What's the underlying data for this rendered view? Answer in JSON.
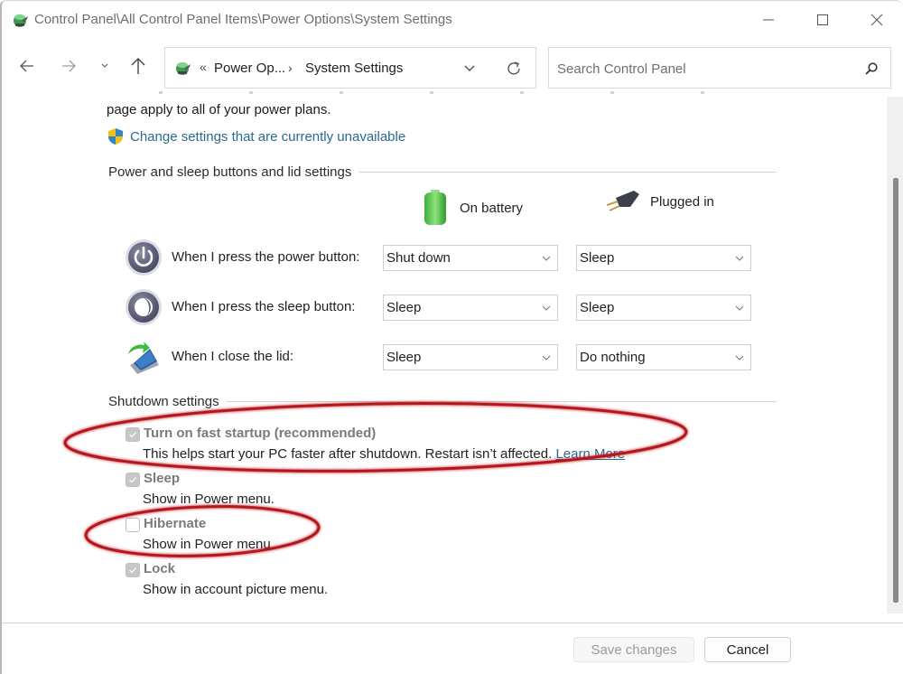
{
  "window": {
    "title": "Control Panel\\All Control Panel Items\\Power Options\\System Settings",
    "controls": {
      "minimize": "minimize",
      "maximize": "maximize",
      "close": "close"
    }
  },
  "navigation": {
    "back_icon": "arrow-left-icon",
    "forward_icon": "arrow-right-icon",
    "recent_icon": "chevron-down-icon",
    "up_icon": "arrow-up-icon",
    "address": {
      "overflow_glyph": "«",
      "segments": [
        "Power Op...",
        "System Settings"
      ],
      "separator": "›"
    },
    "search": {
      "placeholder": "Search Control Panel",
      "value": ""
    }
  },
  "content": {
    "intro_text": "page apply to all of your power plans.",
    "uac_link": "Change settings that are currently unavailable",
    "power_group": {
      "title": "Power and sleep buttons and lid settings",
      "columns": [
        "On battery",
        "Plugged in"
      ],
      "rows": [
        {
          "label": "When I press the power button:",
          "icon": "power-button-icon",
          "on_battery": "Shut down",
          "plugged_in": "Sleep"
        },
        {
          "label": "When I press the sleep button:",
          "icon": "sleep-button-icon",
          "on_battery": "Sleep",
          "plugged_in": "Sleep"
        },
        {
          "label": "When I close the lid:",
          "icon": "laptop-lid-icon",
          "on_battery": "Sleep",
          "plugged_in": "Do nothing"
        }
      ]
    },
    "shutdown_group": {
      "title": "Shutdown settings",
      "items": [
        {
          "title": "Turn on fast startup (recommended)",
          "description": "This helps start your PC faster after shutdown. Restart isn’t affected.",
          "link": "Learn More",
          "checked": true,
          "disabled": true
        },
        {
          "title": "Sleep",
          "description": "Show in Power menu.",
          "checked": true,
          "disabled": true
        },
        {
          "title": "Hibernate",
          "description": "Show in Power menu.",
          "checked": false,
          "disabled": true
        },
        {
          "title": "Lock",
          "description": "Show in account picture menu.",
          "checked": true,
          "disabled": true
        }
      ]
    },
    "annotations": {
      "color": "#c0141c",
      "highlighted_items": [
        "Turn on fast startup (recommended)",
        "Hibernate"
      ]
    }
  },
  "footer": {
    "save_label": "Save changes",
    "save_enabled": false,
    "cancel_label": "Cancel"
  }
}
